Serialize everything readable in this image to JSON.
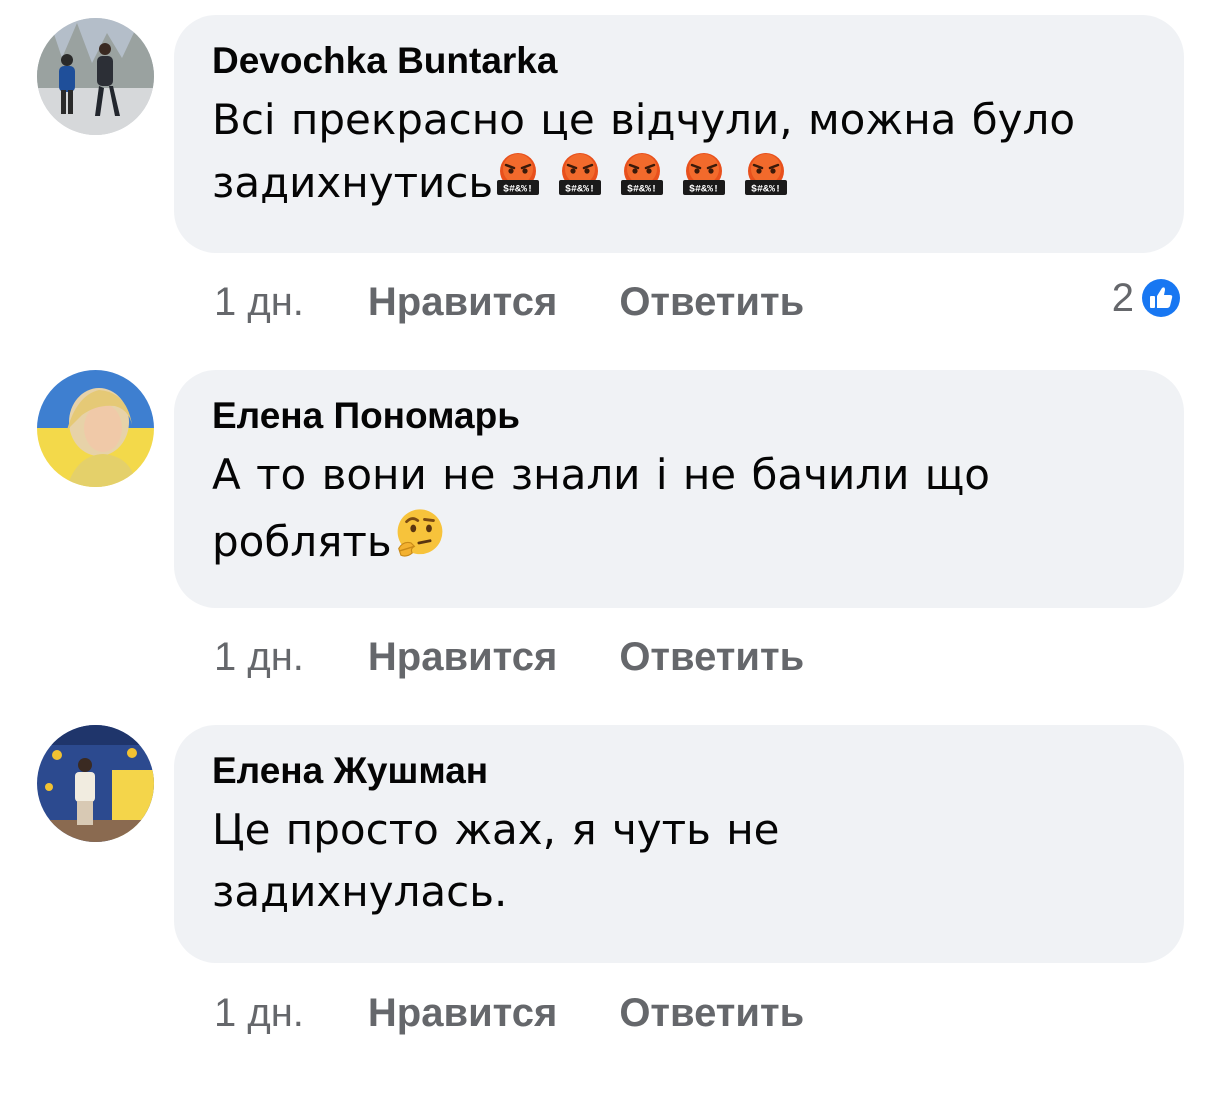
{
  "comments": [
    {
      "author": "Devochka Buntarka",
      "text": "Всі прекрасно це відчули, можна було задихнутись",
      "emoji_icons": [
        "cursing-face-icon",
        "cursing-face-icon",
        "cursing-face-icon",
        "cursing-face-icon",
        "cursing-face-icon"
      ],
      "time": "1 дн.",
      "like_label": "Нравится",
      "reply_label": "Ответить",
      "reaction_count": "2",
      "reaction_icon": "like-icon"
    },
    {
      "author": "Елена Пономарь",
      "text": "А то вони не знали і не бачили що роблять",
      "emoji_icons": [
        "thinking-face-icon"
      ],
      "time": "1 дн.",
      "like_label": "Нравится",
      "reply_label": "Ответить"
    },
    {
      "author": "Елена Жушман",
      "text": "Це просто жах, я чуть не задихнулась.",
      "time": "1 дн.",
      "like_label": "Нравится",
      "reply_label": "Ответить"
    }
  ],
  "colors": {
    "bubble_background": "#f0f2f5",
    "meta_text": "#65676b",
    "like_badge": "#1877f2"
  }
}
